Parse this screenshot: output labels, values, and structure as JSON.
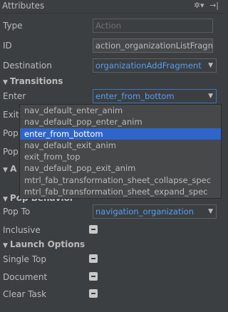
{
  "header": {
    "title": "Attributes"
  },
  "fields": {
    "type_label": "Type",
    "type_placeholder": "Action",
    "id_label": "ID",
    "id_value": "action_organizationListFragm",
    "destination_label": "Destination",
    "destination_value": "organizationAddFragment"
  },
  "transitions": {
    "section_label": "Transitions",
    "enter_label": "Enter",
    "enter_value": "enter_from_bottom",
    "exit_label_partial": "Exit",
    "pop_enter_partial": "Pop",
    "pop_exit_partial": "Pop"
  },
  "argument_section_partial": "A",
  "popup_items": [
    "nav_default_enter_anim",
    "nav_default_pop_enter_anim",
    "enter_from_bottom",
    "nav_default_exit_anim",
    "exit_from_top",
    "nav_default_pop_exit_anim",
    "mtrl_fab_transformation_sheet_collapse_spec",
    "mtrl_fab_transformation_sheet_expand_spec"
  ],
  "pop_behavior": {
    "section_label": "Pop Behavior",
    "pop_to_label": "Pop To",
    "pop_to_value": "navigation_organization",
    "inclusive_label": "Inclusive"
  },
  "launch_options": {
    "section_label": "Launch Options",
    "single_top_label": "Single Top",
    "document_label": "Document",
    "clear_task_label": "Clear Task"
  },
  "colors": {
    "background": "#3c3f41",
    "accent_blue": "#589df6",
    "selection": "#2f65ca"
  }
}
